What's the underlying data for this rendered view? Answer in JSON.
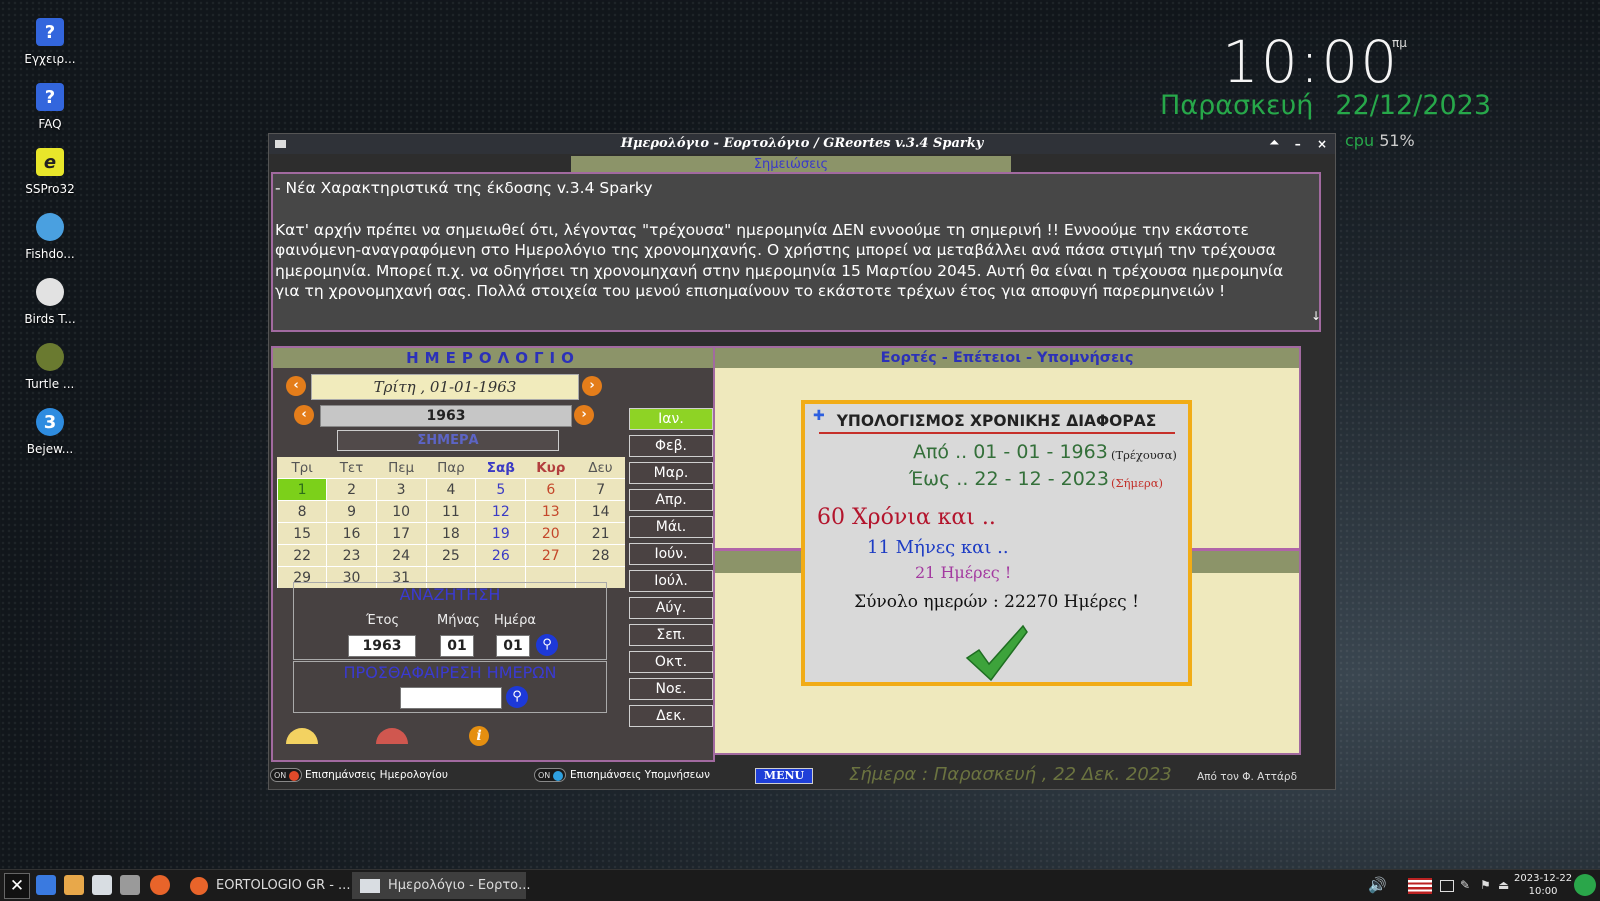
{
  "desktop_icons": [
    "Εγχειρ...",
    "FAQ",
    "SSPro32",
    "Fishdo...",
    "Birds T...",
    "Turtle ...",
    "Bejew..."
  ],
  "clock": {
    "time": "10:00",
    "ampm": "πμ",
    "weekday": "Παρασκευή",
    "date": "22/12/2023",
    "cpu_label": "cpu",
    "cpu_value": "51%"
  },
  "window": {
    "title": "Ημερολόγιο - Εορτολόγιο / GReortes v.3.4 Sparky",
    "controls": [
      "🞁",
      "–",
      "×"
    ]
  },
  "notes": {
    "tab": "Σημειώσεις",
    "line1": "- Νέα Χαρακτηριστικά της έκδοσης v.3.4 Sparky",
    "line2": "Κατ' αρχήν πρέπει να σημειωθεί ότι, λέγοντας \"τρέχουσα\" ημερομηνία ΔΕΝ εννοούμε τη σημερινή !! Εννοούμε την εκάστοτε φαινόμενη-αναγραφόμενη στο Ημερολόγιο της χρονομηχανής. Ο χρήστης μπορεί να μεταβάλλει ανά πάσα στιγμή την τρέχουσα ημερομηνία. Μπορεί π.χ. να οδηγήσει τη χρονομηχανή στην ημερομηνία 15 Μαρτίου 2045. Αυτή θα είναι η τρέχουσα ημερομηνία για τη χρονομηχανή σας. Πολλά στοιχεία του μενού επισημαίνουν το εκάστοτε τρέχων έτος για αποφυγή παρερμηνειών !"
  },
  "calendar": {
    "header": "ΗΜΕΡΟΛΟΓΙΟ",
    "current_day": "Τρίτη , 01-01-1963",
    "year": "1963",
    "today_button": "ΣΗΜΕΡΑ",
    "weekdays": [
      "Τρι",
      "Τετ",
      "Πεμ",
      "Παρ",
      "Σαβ",
      "Κυρ",
      "Δευ"
    ],
    "weeks": [
      [
        "1",
        "2",
        "3",
        "4",
        "5",
        "6",
        "7"
      ],
      [
        "8",
        "9",
        "10",
        "11",
        "12",
        "13",
        "14"
      ],
      [
        "15",
        "16",
        "17",
        "18",
        "19",
        "20",
        "21"
      ],
      [
        "22",
        "23",
        "24",
        "25",
        "26",
        "27",
        "28"
      ],
      [
        "29",
        "30",
        "31",
        "",
        "",
        "",
        ""
      ]
    ],
    "months": [
      "Ιαν.",
      "Φεβ.",
      "Μαρ.",
      "Απρ.",
      "Μάι.",
      "Ιούν.",
      "Ιούλ.",
      "Αύγ.",
      "Σεπ.",
      "Οκτ.",
      "Νοε.",
      "Δεκ."
    ],
    "active_month": "Ιαν."
  },
  "search": {
    "title": "ΑΝΑΖΗΤΗΣΗ",
    "year_label": "Έτος",
    "month_label": "Μήνας",
    "day_label": "Ημέρα",
    "year_value": "1963",
    "month_value": "01",
    "day_value": "01"
  },
  "add_days": {
    "title": "ΠΡΟΣΘΑΦΑΙΡΕΣΗ ΗΜΕΡΩΝ",
    "value": ""
  },
  "events": {
    "header": "Εορτές - Επέτειοι - Υπομνήσεις"
  },
  "dialog": {
    "title": "ΥΠΟΛΟΓΙΣΜΟΣ ΧΡΟΝΙΚΗΣ ΔΙΑΦΟΡΑΣ",
    "from": "Από .. 01 - 01 - 1963",
    "from_tag": "(Τρέχουσα)",
    "to": "Έως .. 22 - 12 - 2023",
    "to_tag": "(Σήμερα)",
    "years": "60 Χρόνια και ..",
    "months": "11 Μήνες και ..",
    "days": "21 Ημέρες !",
    "total": "Σύνολο ημερών : 22270 Ημέρες !"
  },
  "status": {
    "toggle_on": "ON",
    "cal_highlights": "Επισημάνσεις Ημερολογίου",
    "rem_highlights": "Επισημάνσεις Υπομνήσεων",
    "menu": "MENU",
    "today": "Σήμερα : Παρασκευή , 22 Δεκ. 2023",
    "author": "Από τον Φ. Αττάρδ"
  },
  "taskbar": {
    "task1": "EORTOLOGIO GR - ...",
    "task2": "Ημερολόγιο - Εορτο...",
    "clock_date": "2023-12-22",
    "clock_time": "10:00"
  },
  "colors": {
    "accent_green": "#27a84a",
    "panel_olive": "#8c9469",
    "dialog_border": "#f1ac16",
    "menu_blue": "#1f3fd8"
  }
}
